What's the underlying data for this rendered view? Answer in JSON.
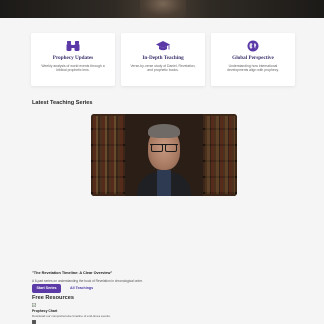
{
  "features": [
    {
      "icon": "binoculars-icon",
      "title": "Prophecy Updates",
      "description": "Weekly analysis of world events through a biblical prophetic lens."
    },
    {
      "icon": "graduation-cap-icon",
      "title": "In-Depth Teaching",
      "description": "Verse-by-verse study of Daniel, Revelation, and prophetic books."
    },
    {
      "icon": "globe-icon",
      "title": "Global Perspective",
      "description": "Understanding how international developments align with prophecy."
    }
  ],
  "latest": {
    "section_title": "Latest Teaching Series",
    "series_title": "\"The Revelation Timeline: A Clear Overview\"",
    "series_description": "A 6-part series on understanding the book of Revelation in chronological order.",
    "start_button": "Start Series",
    "all_link": "All Teachings"
  },
  "resources": {
    "section_title": "Free Resources",
    "items": [
      {
        "name": "Prophecy Chart",
        "description": "Download our comprehensive timeline of end-times events."
      }
    ]
  },
  "colors": {
    "accent": "#5b3aa8",
    "card_title": "#3a2f6b",
    "background": "#f5f5f6"
  }
}
